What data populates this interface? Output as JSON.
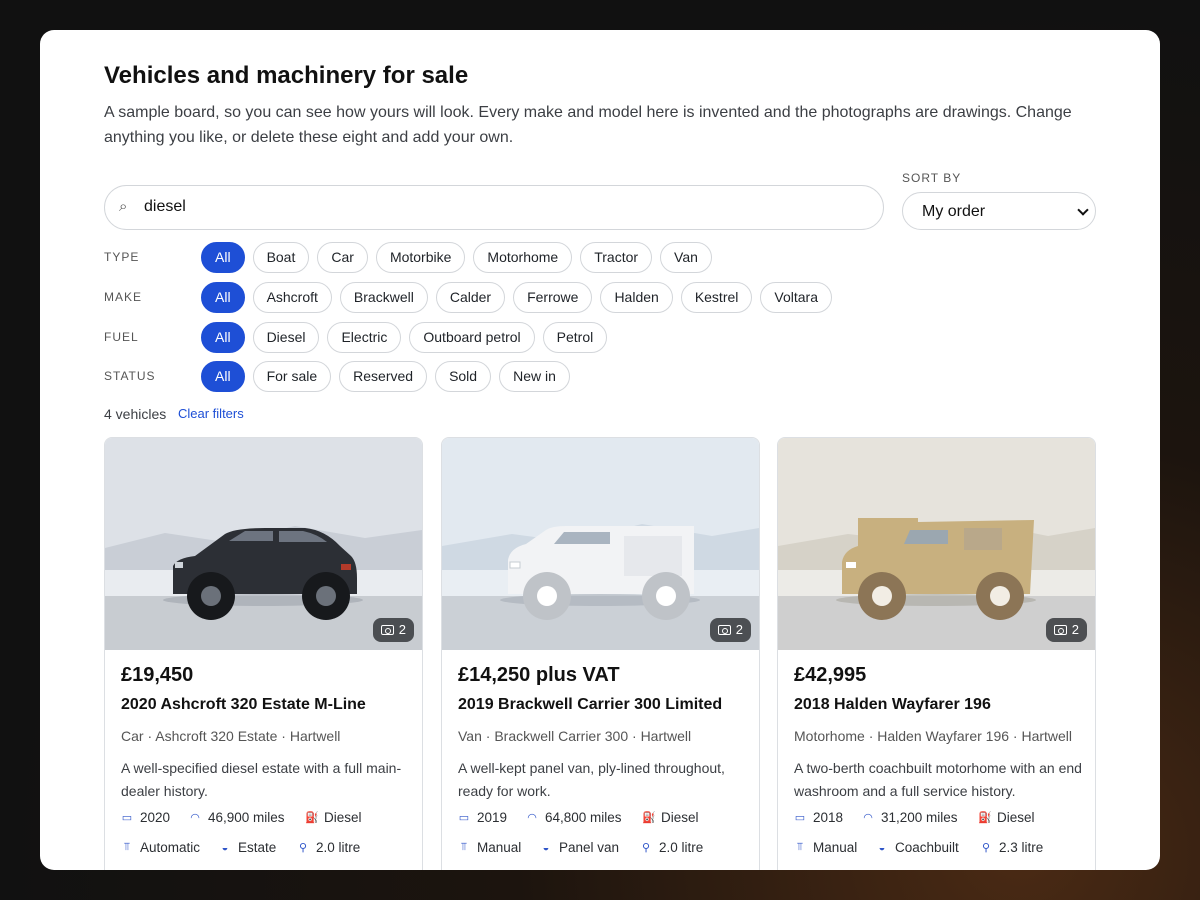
{
  "header": {
    "title": "Vehicles and machinery for sale",
    "description": "A sample board, so you can see how yours will look. Every make and model here is invented and the photographs are drawings. Change anything you like, or delete these eight and add your own."
  },
  "search": {
    "value": "diesel",
    "icon": "search-icon"
  },
  "sort": {
    "label": "SORT BY",
    "value": "My order"
  },
  "filters": {
    "type": {
      "label": "TYPE",
      "options": [
        "All",
        "Boat",
        "Car",
        "Motorbike",
        "Motorhome",
        "Tractor",
        "Van"
      ]
    },
    "make": {
      "label": "MAKE",
      "options": [
        "All",
        "Ashcroft",
        "Brackwell",
        "Calder",
        "Ferrowe",
        "Halden",
        "Kestrel",
        "Voltara"
      ]
    },
    "fuel": {
      "label": "FUEL",
      "options": [
        "All",
        "Diesel",
        "Electric",
        "Outboard petrol",
        "Petrol"
      ]
    },
    "status": {
      "label": "STATUS",
      "options": [
        "All",
        "For sale",
        "Reserved",
        "Sold",
        "New in"
      ]
    }
  },
  "results": {
    "count": "4 vehicles",
    "clear": "Clear filters"
  },
  "colors": {
    "accent": "#1e4fd6"
  },
  "cards": [
    {
      "photo_count": "2",
      "price": "£19,450",
      "name": "2020 Ashcroft 320 Estate M-Line",
      "sub": "Car · Ashcroft 320 Estate · Hartwell",
      "blurb": "A well-specified diesel estate with a full main-dealer history.",
      "year": "2020",
      "mileage": "46,900 miles",
      "fuel": "Diesel",
      "gearbox": "Automatic",
      "body": "Estate",
      "engine": "2.0 litre"
    },
    {
      "photo_count": "2",
      "price": "£14,250 plus VAT",
      "name": "2019 Brackwell Carrier 300 Limited",
      "sub": "Van · Brackwell Carrier 300 · Hartwell",
      "blurb": "A well-kept panel van, ply-lined throughout, ready for work.",
      "year": "2019",
      "mileage": "64,800 miles",
      "fuel": "Diesel",
      "gearbox": "Manual",
      "body": "Panel van",
      "engine": "2.0 litre"
    },
    {
      "photo_count": "2",
      "price": "£42,995",
      "name": "2018 Halden Wayfarer 196",
      "sub": "Motorhome · Halden Wayfarer 196 · Hartwell",
      "blurb": "A two-berth coachbuilt motorhome with an end washroom and a full service history.",
      "year": "2018",
      "mileage": "31,200 miles",
      "fuel": "Diesel",
      "gearbox": "Manual",
      "body": "Coachbuilt",
      "engine": "2.3 litre"
    }
  ]
}
